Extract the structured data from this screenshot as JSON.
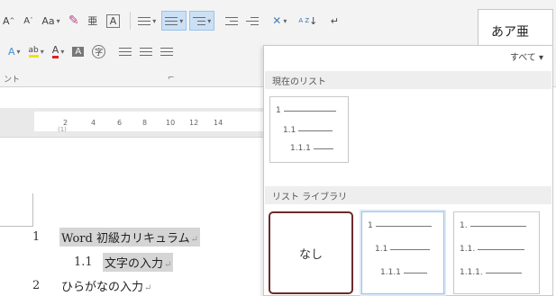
{
  "ribbon": {
    "row1": {
      "font_grow": "A",
      "font_shrink": "A",
      "change_case": "Aa",
      "change_case_caret": "▾",
      "clear_format_icon": "eraser-icon",
      "phonetic_guide": "亜",
      "char_border": "A",
      "bullets_caret": "▾",
      "numbering_caret": "▾",
      "multilevel_caret": "▾",
      "outdent_icon": "decrease-indent-icon",
      "indent_icon": "increase-indent-icon",
      "asian_layout_icon": "asian-layout-icon",
      "asian_layout_caret": "▾",
      "sort_label": "↓",
      "sort_letters": "A Z",
      "show_marks": "↵"
    },
    "row2": {
      "text_effects": "A",
      "text_effects_caret": "▾",
      "highlight": "ab",
      "highlight_caret": "▾",
      "font_color": "A",
      "font_color_caret": "▾",
      "char_shading": "A",
      "enclose_char": "字"
    },
    "group_label": "ント",
    "group_launcher": "⌐",
    "style_sample": "あア亜"
  },
  "ruler": {
    "numbers": [
      "2",
      "4",
      "6",
      "8",
      "10",
      "12",
      "14"
    ],
    "sub_mark": "(1)"
  },
  "document": {
    "lines": [
      {
        "num": "1",
        "text": "Word 初級カリキュラム",
        "mark": "↵",
        "highlight": true
      },
      {
        "num": "1.1",
        "text": "文字の入力",
        "mark": "↵",
        "highlight": true
      },
      {
        "num": "2",
        "text": "ひらがなの入力",
        "mark": "↵",
        "highlight": false
      }
    ]
  },
  "list_panel": {
    "filter_label": "すべて ▾",
    "current_section_title": "現在のリスト",
    "library_section_title": "リスト ライブラリ",
    "current_list": {
      "levels": [
        "1",
        "1.1",
        "1.1.1"
      ]
    },
    "library": [
      {
        "label": "なし"
      },
      {
        "levels": [
          "1",
          "1.1",
          "1.1.1"
        ]
      },
      {
        "levels": [
          "1.",
          "1.1.",
          "1.1.1."
        ]
      }
    ]
  },
  "colors": {
    "ribbon_bg": "#f3f3f3",
    "selected_button": "#cce0f5",
    "section_header": "#eeeeee",
    "none_border": "#6b2c2c"
  }
}
